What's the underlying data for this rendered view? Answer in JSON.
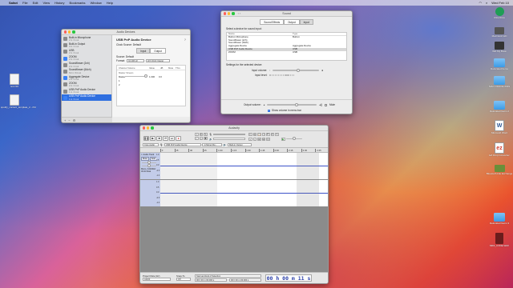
{
  "menubar": {
    "app": "Safari",
    "items": [
      "File",
      "Edit",
      "View",
      "History",
      "Bookmarks",
      "Window",
      "Help"
    ],
    "clock": "Wed Feb 10"
  },
  "desktop_left": [
    {
      "label": "text.rtfd"
    },
    {
      "label": "spotify_content_template_2...rtfd"
    }
  ],
  "desktop_right": [
    {
      "label": "Ultra Drive"
    },
    {
      "label": "Macintosh HD"
    },
    {
      "label": "WD My Book"
    },
    {
      "label": "Relocated Items"
    },
    {
      "label": "MAC OFFICE 2019"
    },
    {
      "label": "Relocated Items 2"
    },
    {
      "label": "Microsoft Word"
    },
    {
      "label": "EZ Drop Converter"
    },
    {
      "label": "Bluetooth File Exchange"
    },
    {
      "label": "Relocated Items 3"
    },
    {
      "label": "MIDI_CODE.WAV"
    }
  ],
  "ams": {
    "title": "Audio Devices",
    "devices": [
      {
        "name": "Built-in Microphone",
        "sub": "2 in / 0 out",
        "blue": false
      },
      {
        "name": "Built-in Output",
        "sub": "0 in / 2 out",
        "blue": false
      },
      {
        "name": "USB",
        "sub": "2 in / 0 out",
        "blue": false
      },
      {
        "name": "ZOOM",
        "sub": "2 in / 2 out",
        "blue": true
      },
      {
        "name": "Soundflower (2ch)",
        "sub": "2 in / 2 out",
        "blue": false
      },
      {
        "name": "Soundflower (64ch)",
        "sub": "64 in / 64 out",
        "blue": false
      },
      {
        "name": "Aggregate Device",
        "sub": "2 in / 2 out",
        "blue": true
      },
      {
        "name": "ZOOM",
        "sub": "2 in / 2 out",
        "blue": false
      },
      {
        "name": "USB PnP Audio Device",
        "sub": "1 in / 0 out",
        "blue": false
      },
      {
        "name": "USB PnP Audio Device",
        "sub": "1 in / 0 out",
        "blue": true
      }
    ],
    "selected_index": 9,
    "device_title": "USB PnP Audio Device",
    "clock_source_label": "Clock Source:",
    "clock_source_value": "Default",
    "tabs": [
      "Input",
      "Output"
    ],
    "source_label": "Source:",
    "source_value": "Default",
    "format_label": "Format:",
    "format_value": "44,100 Hz",
    "format_channels": "2ch 16-bit Integer",
    "channel_header": [
      "Channel Volume",
      "Value",
      "dB",
      "Mute",
      "Thru"
    ],
    "master_label": "Master Stream",
    "rows": [
      {
        "name": "Master",
        "value": "1.000",
        "db": "0.0"
      },
      {
        "name": "1",
        "value": "",
        "db": ""
      },
      {
        "name": "2",
        "value": "",
        "db": ""
      }
    ],
    "bottom": [
      "+",
      "−",
      "⚙"
    ]
  },
  "sound": {
    "title": "Sound",
    "tabs": [
      "Sound Effects",
      "Output",
      "Input"
    ],
    "active_tab": 2,
    "select_label": "Select a device for sound input:",
    "col_name": "Name",
    "col_type": "Type",
    "devices": [
      {
        "name": "Built-in Microphone",
        "type": "Built-in"
      },
      {
        "name": "Soundflower (2ch)",
        "type": ""
      },
      {
        "name": "Soundflower (64ch)",
        "type": ""
      },
      {
        "name": "Aggregate Device",
        "type": "Aggregate Device"
      },
      {
        "name": "USB PnP Audio Device",
        "type": "USB"
      },
      {
        "name": "ZOOM",
        "type": "USB"
      }
    ],
    "selected_index": 4,
    "settings_label": "Settings for the selected device:",
    "input_volume_label": "Input volume:",
    "input_level_label": "Input level:",
    "input_volume": 0.55,
    "output_volume_label": "Output volume:",
    "output_volume": 0.6,
    "mute_label": "Mute",
    "show_volume_label": "Show volume in menu bar"
  },
  "audacity": {
    "title": "Audacity",
    "host": "Core Audio",
    "rec_device": "USB PnP Audio Device",
    "rec_channels": "1 (Mono) Re...",
    "play_device": "Built-in Output",
    "ruler_ticks": [
      "0",
      "15",
      "30",
      "45",
      "1:00",
      "1:15",
      "1:30",
      "1:45",
      "2:00",
      "2:15",
      "2:30",
      "2:45"
    ],
    "track_name": "Audio Track",
    "track_info": "Mono, 44100Hz 32-bit float",
    "scale": [
      "1.0",
      "0.5",
      "0.0",
      "-0.5",
      "-1.0"
    ],
    "project_rate_label": "Project Rate (Hz)",
    "project_rate": "44100",
    "snap_label": "Snap-To",
    "snap_value": "Off",
    "selection_label": "Start and End of Selection",
    "sel_start": "00 h 00 m 00.000 s",
    "sel_end": "00 h 00 m 00.000 s",
    "time": "00 h 00 m 11 s"
  }
}
